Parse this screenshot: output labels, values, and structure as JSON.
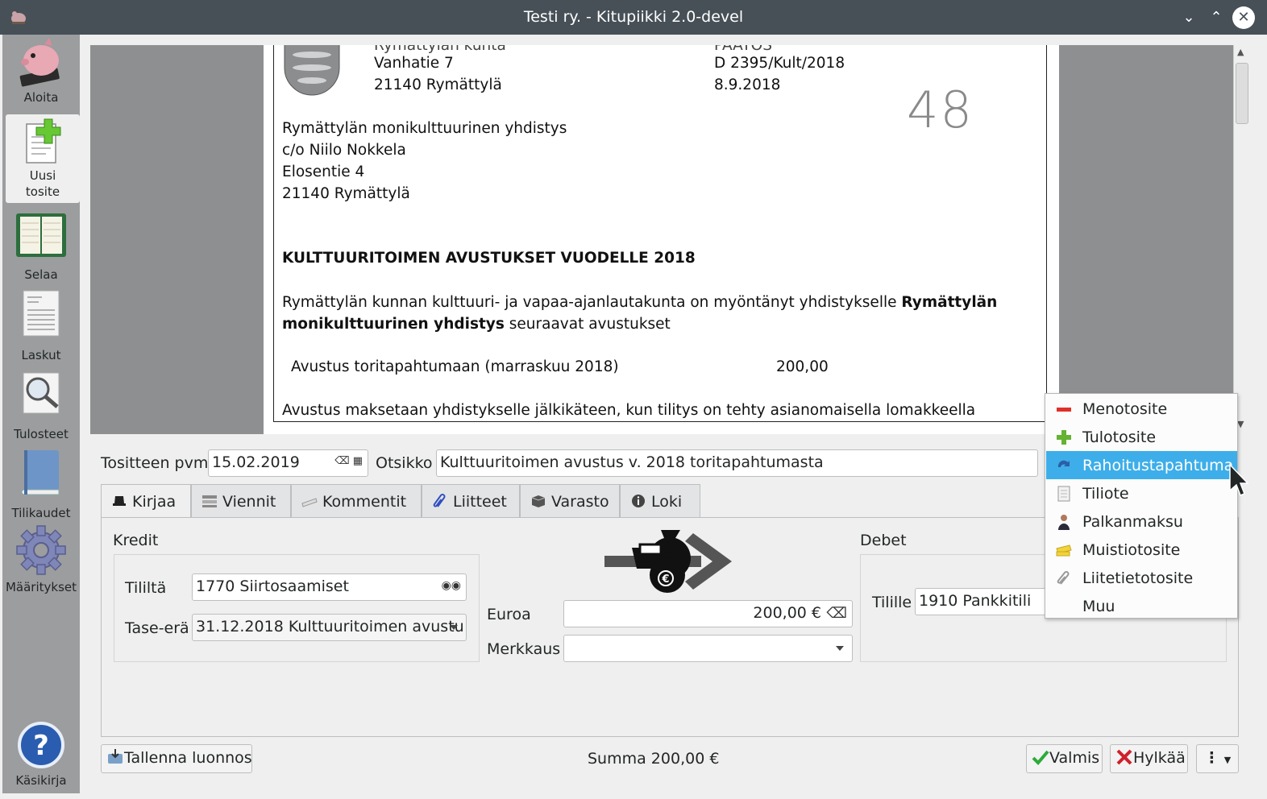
{
  "window": {
    "title": "Testi ry. - Kitupiikki 2.0-devel"
  },
  "sidebar": {
    "items": [
      {
        "label": "Aloita",
        "icon": "piggy-bank-icon"
      },
      {
        "label": "Uusi",
        "label2": "tosite",
        "icon": "new-document-icon",
        "active": true
      },
      {
        "label": "Selaa",
        "icon": "ledger-icon"
      },
      {
        "label": "Laskut",
        "icon": "invoice-icon"
      },
      {
        "label": "Tulosteet",
        "icon": "print-preview-icon"
      },
      {
        "label": "Tilikaudet",
        "icon": "book-icon"
      },
      {
        "label": "Määritykset",
        "icon": "gear-icon"
      },
      {
        "label": "Käsikirja",
        "icon": "help-icon"
      }
    ]
  },
  "document": {
    "sender_lines": [
      "Vanhatie 7",
      "21140 Rymättylä"
    ],
    "decision_lines": [
      "D 2395/Kult/2018",
      "8.9.2018"
    ],
    "handwritten_number": "48",
    "recipient_lines": [
      "Rymättylän monikulttuurinen yhdistys",
      "c/o Niilo Nokkela",
      "Elosentie 4",
      "21140 Rymättylä"
    ],
    "heading": "KULTTUURITOIMEN AVUSTUKSET VUODELLE 2018",
    "body_part1": "Rymättylän kunnan kulttuuri- ja vapaa-ajanlautakunta on myöntänyt yhdistykselle ",
    "body_bold1": "Rymättylän",
    "body_bold2": "monikulttuurinen yhdistys",
    "body_part2": " seuraavat avustukset",
    "grant_item": "Avustus toritapahtumaan (marraskuu 2018)",
    "grant_amount": "200,00",
    "payment_note": "Avustus maksetaan yhdistykselle jälkikäteen, kun tilitys on tehty asianomaisella lomakkeella"
  },
  "form": {
    "date_label": "Tositteen pvm",
    "date_value": "15.02.2019",
    "title_label": "Otsikko",
    "title_value": "Kulttuuritoimen avustus v. 2018 toritapahtumasta"
  },
  "tabs": [
    {
      "label": "Kirjaa",
      "icon": "hat-icon",
      "active": true
    },
    {
      "label": "Viennit",
      "icon": "list-icon"
    },
    {
      "label": "Kommentit",
      "icon": "comment-icon"
    },
    {
      "label": "Liitteet",
      "icon": "paperclip-icon"
    },
    {
      "label": "Varasto",
      "icon": "box-icon"
    },
    {
      "label": "Loki",
      "icon": "info-icon"
    }
  ],
  "kirjaa": {
    "kredit_label": "Kredit",
    "tililta_label": "Tililtä",
    "tililta_value": "1770 Siirtosaamiset",
    "tase_label": "Tase-erä",
    "tase_value": "31.12.2018 Kulttuuritoimen avustu",
    "euroa_label": "Euroa",
    "euroa_value": "200,00 €",
    "merkkaus_label": "Merkkaus",
    "merkkaus_value": "",
    "debet_label": "Debet",
    "tilille_label": "Tilille",
    "tilille_value": "1910 Pankkitili"
  },
  "bottom": {
    "save_draft": "Tallenna luonnos",
    "summa": "Summa 200,00 €",
    "valmis": "Valmis",
    "hylkaa": "Hylkää"
  },
  "type_menu": {
    "items": [
      {
        "label": "Menotosite",
        "icon": "minus-icon"
      },
      {
        "label": "Tulotosite",
        "icon": "plus-icon"
      },
      {
        "label": "Rahoitustapahtuma",
        "icon": "transfer-icon",
        "selected": true
      },
      {
        "label": "Tiliote",
        "icon": "statement-icon"
      },
      {
        "label": "Palkanmaksu",
        "icon": "person-icon"
      },
      {
        "label": "Muistiotosite",
        "icon": "memo-icon"
      },
      {
        "label": "Liitetietotosite",
        "icon": "attachment-icon"
      },
      {
        "label": "Muu",
        "icon": ""
      }
    ]
  }
}
